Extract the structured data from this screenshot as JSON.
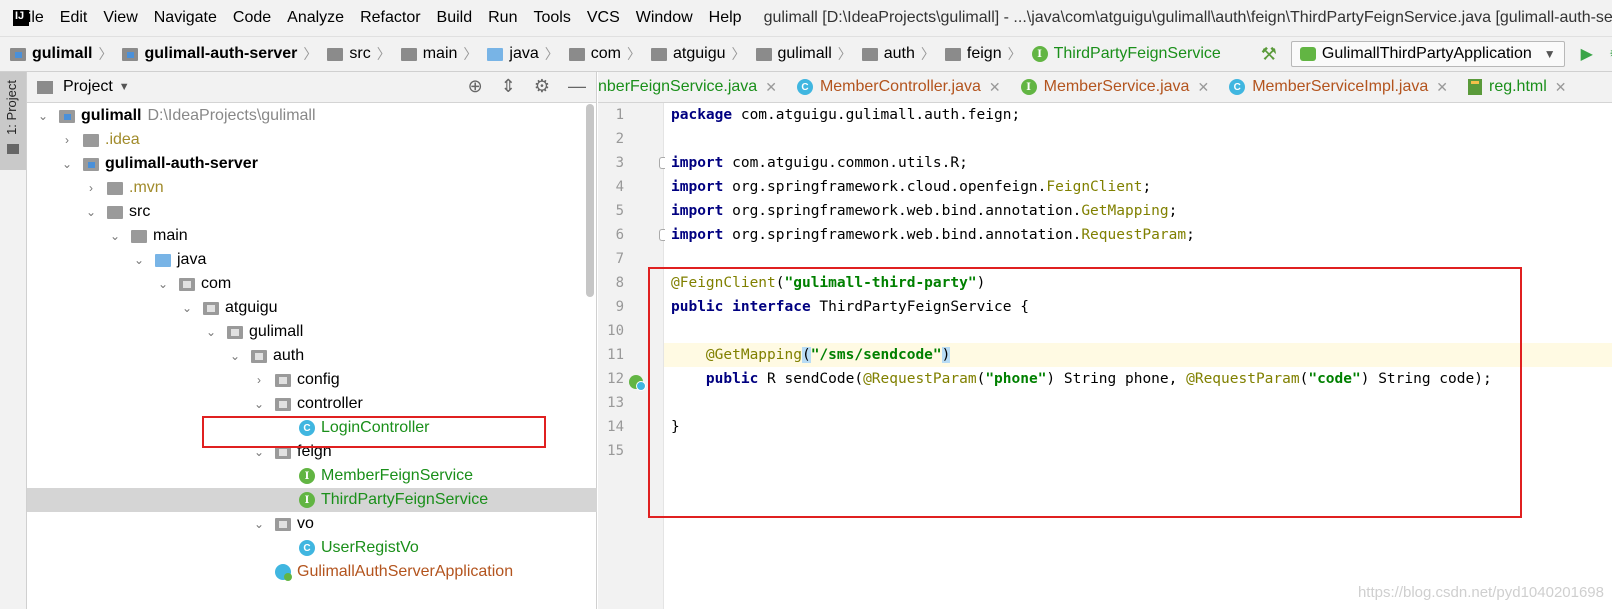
{
  "menu": {
    "items": [
      "File",
      "Edit",
      "View",
      "Navigate",
      "Code",
      "Analyze",
      "Refactor",
      "Build",
      "Run",
      "Tools",
      "VCS",
      "Window",
      "Help"
    ],
    "title": "gulimall [D:\\IdeaProjects\\gulimall] - ...\\java\\com\\atguigu\\gulimall\\auth\\feign\\ThirdPartyFeignService.java [gulimall-auth-server] - IntelliJ IDEA"
  },
  "navbar": {
    "crumbs": [
      "gulimall",
      "gulimall-auth-server",
      "src",
      "main",
      "java",
      "com",
      "atguigu",
      "gulimall",
      "auth",
      "feign"
    ],
    "file": "ThirdPartyFeignService",
    "run_config": "GulimallThirdPartyApplication"
  },
  "tool_stripe": {
    "project_label": "1: Project"
  },
  "project_panel": {
    "title": "Project",
    "tree": [
      {
        "label": "gulimall",
        "path": "D:\\IdeaProjects\\gulimall",
        "depth": 0,
        "arrow": "expanded",
        "kind": "module-root"
      },
      {
        "label": ".idea",
        "depth": 1,
        "arrow": "collapsed",
        "kind": "folder-idea"
      },
      {
        "label": "gulimall-auth-server",
        "depth": 1,
        "arrow": "expanded",
        "kind": "module"
      },
      {
        "label": ".mvn",
        "depth": 2,
        "arrow": "collapsed",
        "kind": "folder-idea"
      },
      {
        "label": "src",
        "depth": 2,
        "arrow": "expanded",
        "kind": "folder"
      },
      {
        "label": "main",
        "depth": 3,
        "arrow": "expanded",
        "kind": "folder"
      },
      {
        "label": "java",
        "depth": 4,
        "arrow": "expanded",
        "kind": "folder-blue"
      },
      {
        "label": "com",
        "depth": 5,
        "arrow": "expanded",
        "kind": "package"
      },
      {
        "label": "atguigu",
        "depth": 6,
        "arrow": "expanded",
        "kind": "package"
      },
      {
        "label": "gulimall",
        "depth": 7,
        "arrow": "expanded",
        "kind": "package"
      },
      {
        "label": "auth",
        "depth": 8,
        "arrow": "expanded",
        "kind": "package"
      },
      {
        "label": "config",
        "depth": 9,
        "arrow": "collapsed",
        "kind": "package"
      },
      {
        "label": "controller",
        "depth": 9,
        "arrow": "expanded",
        "kind": "package"
      },
      {
        "label": "LoginController",
        "depth": 10,
        "arrow": "none",
        "kind": "class"
      },
      {
        "label": "feign",
        "depth": 9,
        "arrow": "expanded",
        "kind": "package"
      },
      {
        "label": "MemberFeignService",
        "depth": 10,
        "arrow": "none",
        "kind": "interface"
      },
      {
        "label": "ThirdPartyFeignService",
        "depth": 10,
        "arrow": "none",
        "kind": "interface",
        "selected": true
      },
      {
        "label": "vo",
        "depth": 9,
        "arrow": "expanded",
        "kind": "package"
      },
      {
        "label": "UserRegistVo",
        "depth": 10,
        "arrow": "none",
        "kind": "class"
      },
      {
        "label": "GulimallAuthServerApplication",
        "depth": 9,
        "arrow": "none",
        "kind": "app"
      }
    ]
  },
  "editor": {
    "tabs": [
      {
        "label": "nberFeignService.java",
        "icon": "none"
      },
      {
        "label": "MemberController.java",
        "icon": "class"
      },
      {
        "label": "MemberService.java",
        "icon": "interface"
      },
      {
        "label": "MemberServiceImpl.java",
        "icon": "class"
      },
      {
        "label": "reg.html",
        "icon": "html"
      }
    ],
    "line_numbers": [
      "1",
      "2",
      "3",
      "4",
      "5",
      "6",
      "7",
      "8",
      "9",
      "10",
      "11",
      "12",
      "13",
      "14",
      "15"
    ],
    "current_line": 11,
    "code": {
      "l1_kw": "package",
      "l1_rest": " com.atguigu.gulimall.auth.feign;",
      "l3_kw": "import",
      "l3_rest": " com.atguigu.common.utils.R;",
      "l4_kw": "import",
      "l4_pre": " org.springframework.cloud.openfeign.",
      "l4_ann": "FeignClient",
      "l4_end": ";",
      "l5_kw": "import",
      "l5_pre": " org.springframework.web.bind.annotation.",
      "l5_ann": "GetMapping",
      "l5_end": ";",
      "l6_kw": "import",
      "l6_pre": " org.springframework.web.bind.annotation.",
      "l6_ann": "RequestParam",
      "l6_end": ";",
      "l8_ann": "@FeignClient",
      "l8_open": "(",
      "l8_str": "\"gulimall-third-party\"",
      "l8_close": ")",
      "l9_kw1": "public",
      "l9_kw2": "interface",
      "l9_rest": " ThirdPartyFeignService {",
      "l11_indent": "    ",
      "l11_ann": "@GetMapping",
      "l11_open": "(",
      "l11_str": "\"/sms/sendcode\"",
      "l11_close": ")",
      "l12_indent": "    ",
      "l12_kw": "public",
      "l12_pre": " R sendCode(",
      "l12_ann1": "@RequestParam",
      "l12_o1": "(",
      "l12_str1": "\"phone\"",
      "l12_mid": ") String phone, ",
      "l12_ann2": "@RequestParam",
      "l12_o2": "(",
      "l12_str2": "\"code\"",
      "l12_end": ") String code);",
      "l14": "}"
    },
    "watermark": "https://blog.csdn.net/pyd1040201698"
  }
}
